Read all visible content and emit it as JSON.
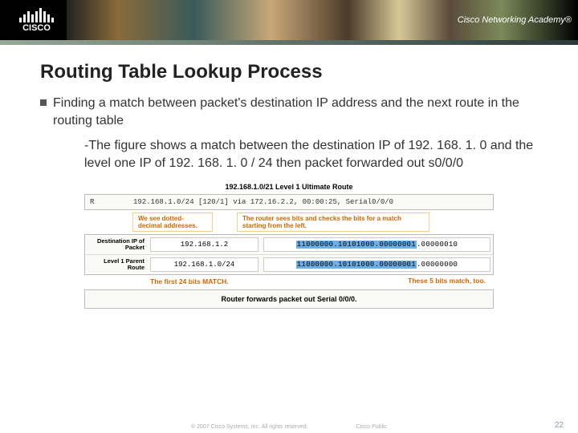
{
  "header": {
    "logo_text": "CISCO",
    "academy": "Cisco Networking Academy®"
  },
  "slide": {
    "title": "Routing Table Lookup Process",
    "bullet": "Finding a match between packet's destination IP address and the next route in the routing table",
    "sub": "-The figure shows a match between the destination IP of 192. 168. 1. 0 and the level one IP of 192. 168. 1. 0 / 24 then packet forwarded out s0/0/0"
  },
  "figure": {
    "title": "192.168.1.0/21 Level 1 Ultimate Route",
    "route_r": "R",
    "route_line": "192.168.1.0/24 [120/1] via 172.16.2.2, 00:00:25, Serial0/0/0",
    "callout1": "We see dotted-decimal addresses.",
    "callout2": "The router sees bits and checks the bits for a match starting from the left.",
    "row1_label": "Destination IP of Packet",
    "row1_ip": "192.168.1.2",
    "row1_bin_hl": "11000000.10101000.00000001",
    "row1_bin_rest": ".00000010",
    "row2_label": "Level 1 Parent Route",
    "row2_ip": "192.168.1.0/24",
    "row2_bin_hl": "11000000.10101000.00000001",
    "row2_bin_rest": ".00000000",
    "match1": "The first 24 bits MATCH.",
    "match2": "These 5 bits match, too.",
    "forward": "Router forwards packet out Serial 0/0/0."
  },
  "footer": {
    "copyright": "© 2007 Cisco Systems, Inc. All rights reserved.",
    "label": "Cisco Public",
    "page": "22"
  }
}
